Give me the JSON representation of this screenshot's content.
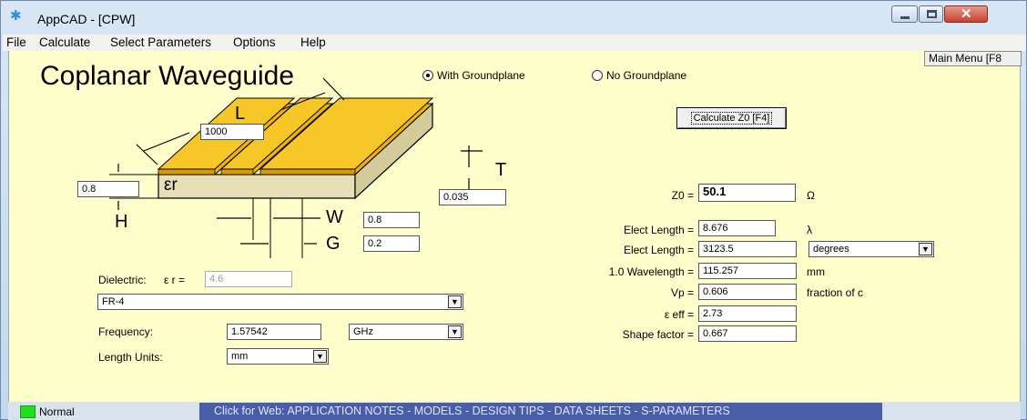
{
  "window": {
    "title": "AppCAD - [CPW]"
  },
  "menu": [
    "File",
    "Calculate",
    "Select Parameters",
    "Options",
    "Help"
  ],
  "header": {
    "title": "Coplanar Waveguide",
    "radio_with": "With Groundplane",
    "radio_without": "No Groundplane",
    "main_menu": "Main Menu [F8"
  },
  "calculate_button": "Calculate Z0  [F4]",
  "diagram": {
    "L": {
      "label": "L",
      "value": "1000"
    },
    "H": {
      "label": "H",
      "value": "0.8"
    },
    "T": {
      "label": "T",
      "value": "0.035"
    },
    "W": {
      "label": "W",
      "value": "0.8"
    },
    "G": {
      "label": "G",
      "value": "0.2"
    },
    "er": "εr"
  },
  "inputs": {
    "dielectric_label": "Dielectric:",
    "er_label": "ε r =",
    "er_value": "4.6",
    "material": "FR-4",
    "frequency_label": "Frequency:",
    "frequency_value": "1.57542",
    "frequency_unit": "GHz",
    "length_units_label": "Length Units:",
    "length_units": "mm"
  },
  "results": {
    "z0_label": "Z0 =",
    "z0_value": "50.1",
    "z0_unit": "Ω",
    "elect_length_label": "Elect Length =",
    "elect_length_value": "8.676",
    "elect_length_unit": "λ",
    "elect_length_deg_label": "Elect Length =",
    "elect_length_deg_value": "3123.5",
    "elect_length_deg_unit": "degrees",
    "wavelength_label": "1.0 Wavelength =",
    "wavelength_value": "115.257",
    "wavelength_unit": "mm",
    "vp_label": "Vp =",
    "vp_value": "0.606",
    "vp_unit": "fraction of c",
    "eeff_label": "ε eff =",
    "eeff_value": "2.73",
    "shape_label": "Shape factor =",
    "shape_value": "0.667"
  },
  "status": {
    "mode": "Normal",
    "web_link": "Click for Web: APPLICATION NOTES - MODELS - DESIGN TIPS - DATA SHEETS - S-PARAMETERS"
  },
  "colors": {
    "client_bg": "#ffffcc",
    "conductor": "#f2b300",
    "substrate": "#e6dfb8",
    "status_link": "#4a5ea8"
  }
}
